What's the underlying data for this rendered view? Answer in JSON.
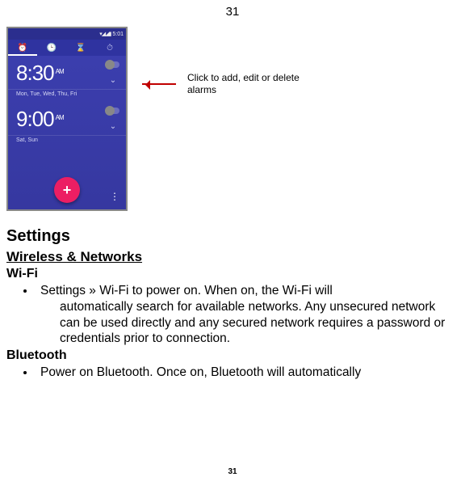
{
  "page_number_top": "31",
  "page_number_bottom": "31",
  "phone": {
    "status_time": "5:01",
    "alarm1_time": "8:30",
    "alarm1_ampm": "AM",
    "alarm1_days": "Mon, Tue, Wed, Thu, Fri",
    "alarm2_time": "9:00",
    "alarm2_ampm": "AM",
    "alarm2_days": "Sat, Sun",
    "fab_label": "+"
  },
  "caption": "Click to add, edit or delete alarms",
  "headings": {
    "settings": "Settings",
    "wireless": "Wireless & Networks",
    "wifi": "Wi-Fi",
    "bluetooth": "Bluetooth"
  },
  "bullets": {
    "wifi_first": "Settings » Wi-Fi to power on. When on, the Wi-Fi will",
    "wifi_rest": "automatically search for available networks. Any unsecured network can be used directly and any secured network requires a password or credentials prior to connection.",
    "bt": "Power on Bluetooth. Once on, Bluetooth will automatically"
  }
}
